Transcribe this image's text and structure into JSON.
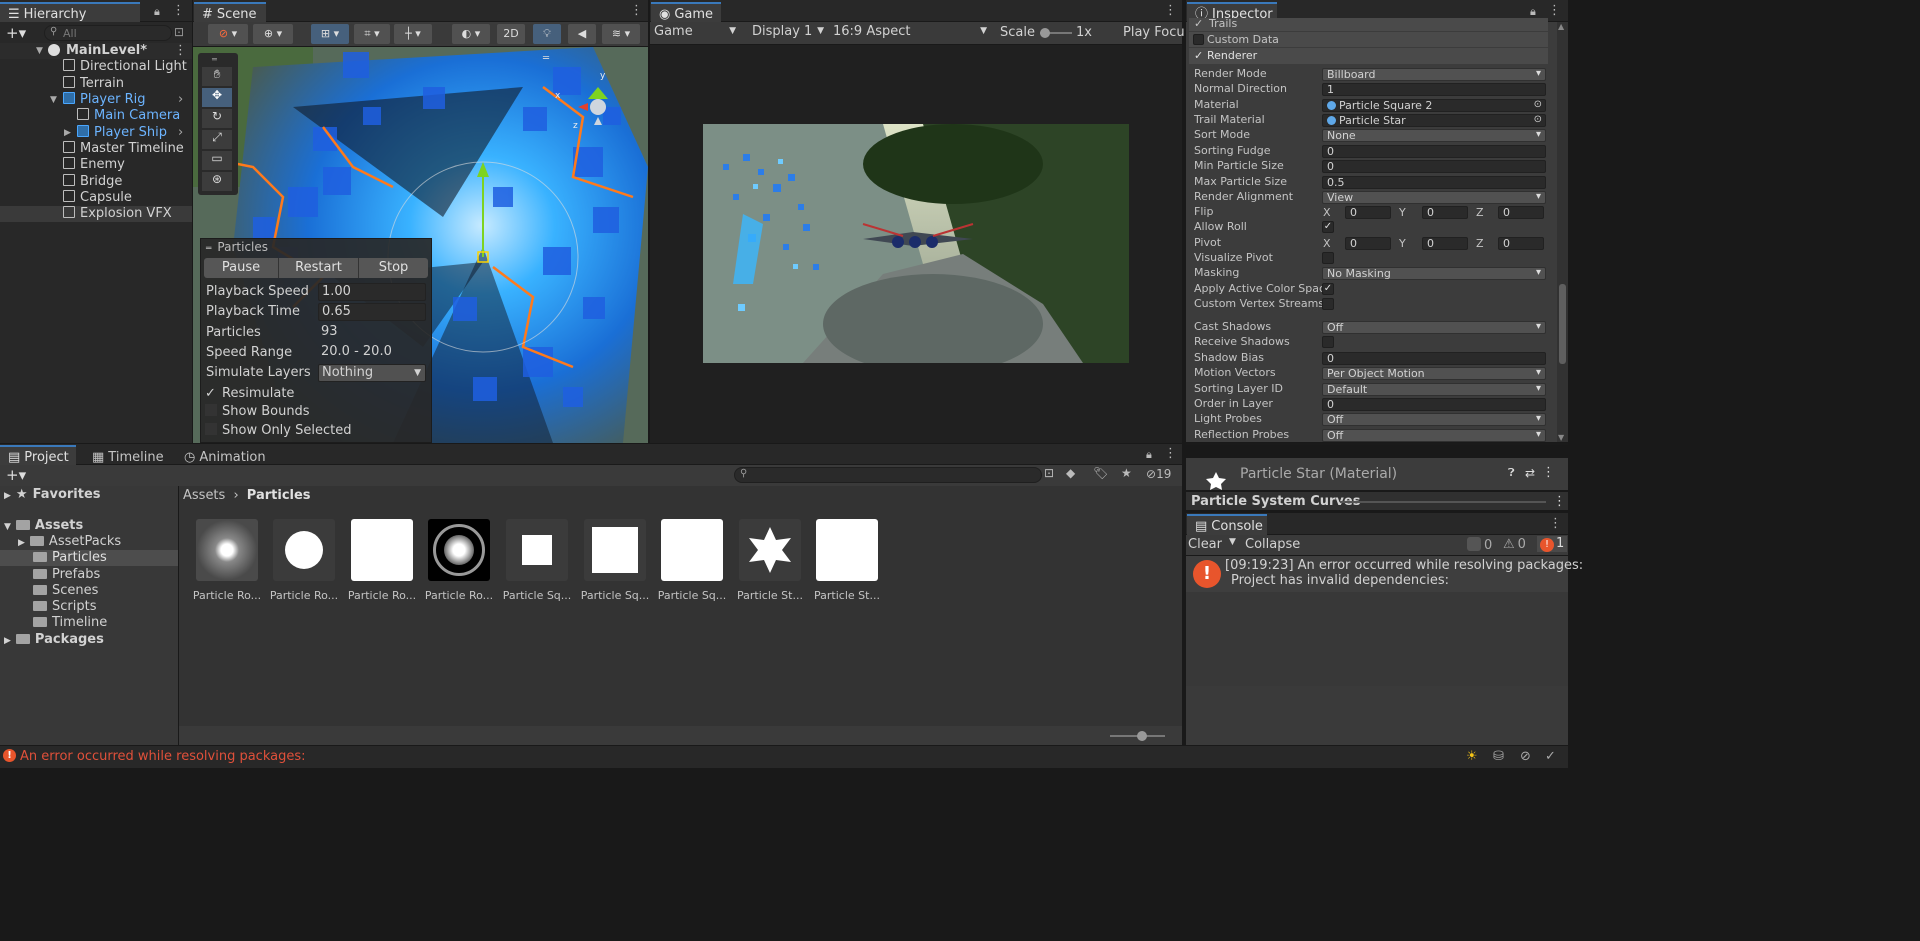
{
  "hierarchy": {
    "tab": "Hierarchy",
    "search_placeholder": "All",
    "items": [
      {
        "label": "MainLevel*",
        "indent": 0
      },
      {
        "label": "Directional Light"
      },
      {
        "label": "Terrain"
      },
      {
        "label": "Player Rig"
      },
      {
        "label": "Main Camera"
      },
      {
        "label": "Player Ship"
      },
      {
        "label": "Master Timeline"
      },
      {
        "label": "Enemy"
      },
      {
        "label": "Bridge"
      },
      {
        "label": "Capsule"
      },
      {
        "label": "Explosion VFX"
      }
    ]
  },
  "scene": {
    "tab": "Scene",
    "btn_2d": "2D",
    "particles_panel": {
      "title": "Particles",
      "pause": "Pause",
      "restart": "Restart",
      "stop": "Stop",
      "rows": [
        {
          "label": "Playback Speed",
          "value": "1.00"
        },
        {
          "label": "Playback Time",
          "value": "0.65"
        },
        {
          "label": "Particles",
          "value": "93"
        },
        {
          "label": "Speed Range",
          "value": "20.0 - 20.0"
        },
        {
          "label": "Simulate Layers",
          "value": "Nothing"
        }
      ],
      "resimulate": "Resimulate",
      "show_bounds": "Show Bounds",
      "show_only_selected": "Show Only Selected"
    },
    "gizmo_y": "y",
    "gizmo_x": "x",
    "gizmo_z": "z"
  },
  "game": {
    "tab": "Game",
    "display_mode": "Game",
    "display": "Display 1",
    "aspect": "16:9 Aspect",
    "scale_label": "Scale",
    "scale_value": "1x",
    "play_focus": "Play Focu"
  },
  "inspector": {
    "tab": "Inspector",
    "module_trails": "Trails",
    "module_custom_data": "Custom Data",
    "module_renderer": "Renderer",
    "rows": [
      {
        "label": "Render Mode",
        "value": "Billboard",
        "kind": "dropdown"
      },
      {
        "label": "Normal Direction",
        "value": "1",
        "kind": "field"
      },
      {
        "label": "Material",
        "value": "Particle Square 2",
        "kind": "object"
      },
      {
        "label": "Trail Material",
        "value": "Particle Star",
        "kind": "object"
      },
      {
        "label": "Sort Mode",
        "value": "None",
        "kind": "dropdown"
      },
      {
        "label": "Sorting Fudge",
        "value": "0",
        "kind": "field"
      },
      {
        "label": "Min Particle Size",
        "value": "0",
        "kind": "field"
      },
      {
        "label": "Max Particle Size",
        "value": "0.5",
        "kind": "field"
      },
      {
        "label": "Render Alignment",
        "value": "View",
        "kind": "dropdown"
      },
      {
        "label": "Flip",
        "kind": "xyz"
      },
      {
        "label": "Allow Roll",
        "kind": "check",
        "checked": true
      },
      {
        "label": "Pivot",
        "kind": "xyz"
      },
      {
        "label": "Visualize Pivot",
        "kind": "check",
        "checked": false
      },
      {
        "label": "Masking",
        "value": "No Masking",
        "kind": "dropdown"
      },
      {
        "label": "Apply Active Color Spac",
        "kind": "check",
        "checked": true
      },
      {
        "label": "Custom Vertex Streams",
        "kind": "check",
        "checked": false
      },
      {
        "label": "Cast Shadows",
        "value": "Off",
        "kind": "dropdown"
      },
      {
        "label": "Receive Shadows",
        "kind": "check",
        "checked": false
      },
      {
        "label": "Shadow Bias",
        "value": "0",
        "kind": "field"
      },
      {
        "label": "Motion Vectors",
        "value": "Per Object Motion",
        "kind": "dropdown"
      },
      {
        "label": "Sorting Layer ID",
        "value": "Default",
        "kind": "dropdown"
      },
      {
        "label": "Order in Layer",
        "value": "0",
        "kind": "field"
      },
      {
        "label": "Light Probes",
        "value": "Off",
        "kind": "dropdown"
      },
      {
        "label": "Reflection Probes",
        "value": "Off",
        "kind": "dropdown"
      }
    ],
    "xyz": {
      "x": "X",
      "y": "Y",
      "z": "Z",
      "zero": "0"
    },
    "material_header": "Particle Star (Material)",
    "curves_header": "Particle System Curves"
  },
  "project": {
    "tabs": [
      "Project",
      "Timeline",
      "Animation"
    ],
    "badge_count": "19",
    "breadcrumb_root": "Assets",
    "breadcrumb_current": "Particles",
    "tree": [
      {
        "label": "Favorites"
      },
      {
        "label": "Assets"
      },
      {
        "label": "AssetPacks"
      },
      {
        "label": "Particles"
      },
      {
        "label": "Prefabs"
      },
      {
        "label": "Scenes"
      },
      {
        "label": "Scripts"
      },
      {
        "label": "Timeline"
      },
      {
        "label": "Packages"
      }
    ],
    "assets": [
      {
        "name": "Particle Ro...",
        "kind": "soft-dot"
      },
      {
        "name": "Particle Ro...",
        "kind": "circle"
      },
      {
        "name": "Particle Ro...",
        "kind": "white"
      },
      {
        "name": "Particle Ro...",
        "kind": "ring"
      },
      {
        "name": "Particle Sq...",
        "kind": "small-square"
      },
      {
        "name": "Particle Sq...",
        "kind": "med-square"
      },
      {
        "name": "Particle Sq...",
        "kind": "white"
      },
      {
        "name": "Particle St...",
        "kind": "star"
      },
      {
        "name": "Particle St...",
        "kind": "white"
      }
    ]
  },
  "console": {
    "tab": "Console",
    "clear": "Clear",
    "collapse": "Collapse",
    "count_info": "0",
    "count_warn": "0",
    "count_error": "1",
    "message_line1": "[09:19:23] An error occurred while resolving packages:",
    "message_line2": "Project has invalid dependencies:"
  },
  "status": {
    "error": "An error occurred while resolving packages:"
  }
}
